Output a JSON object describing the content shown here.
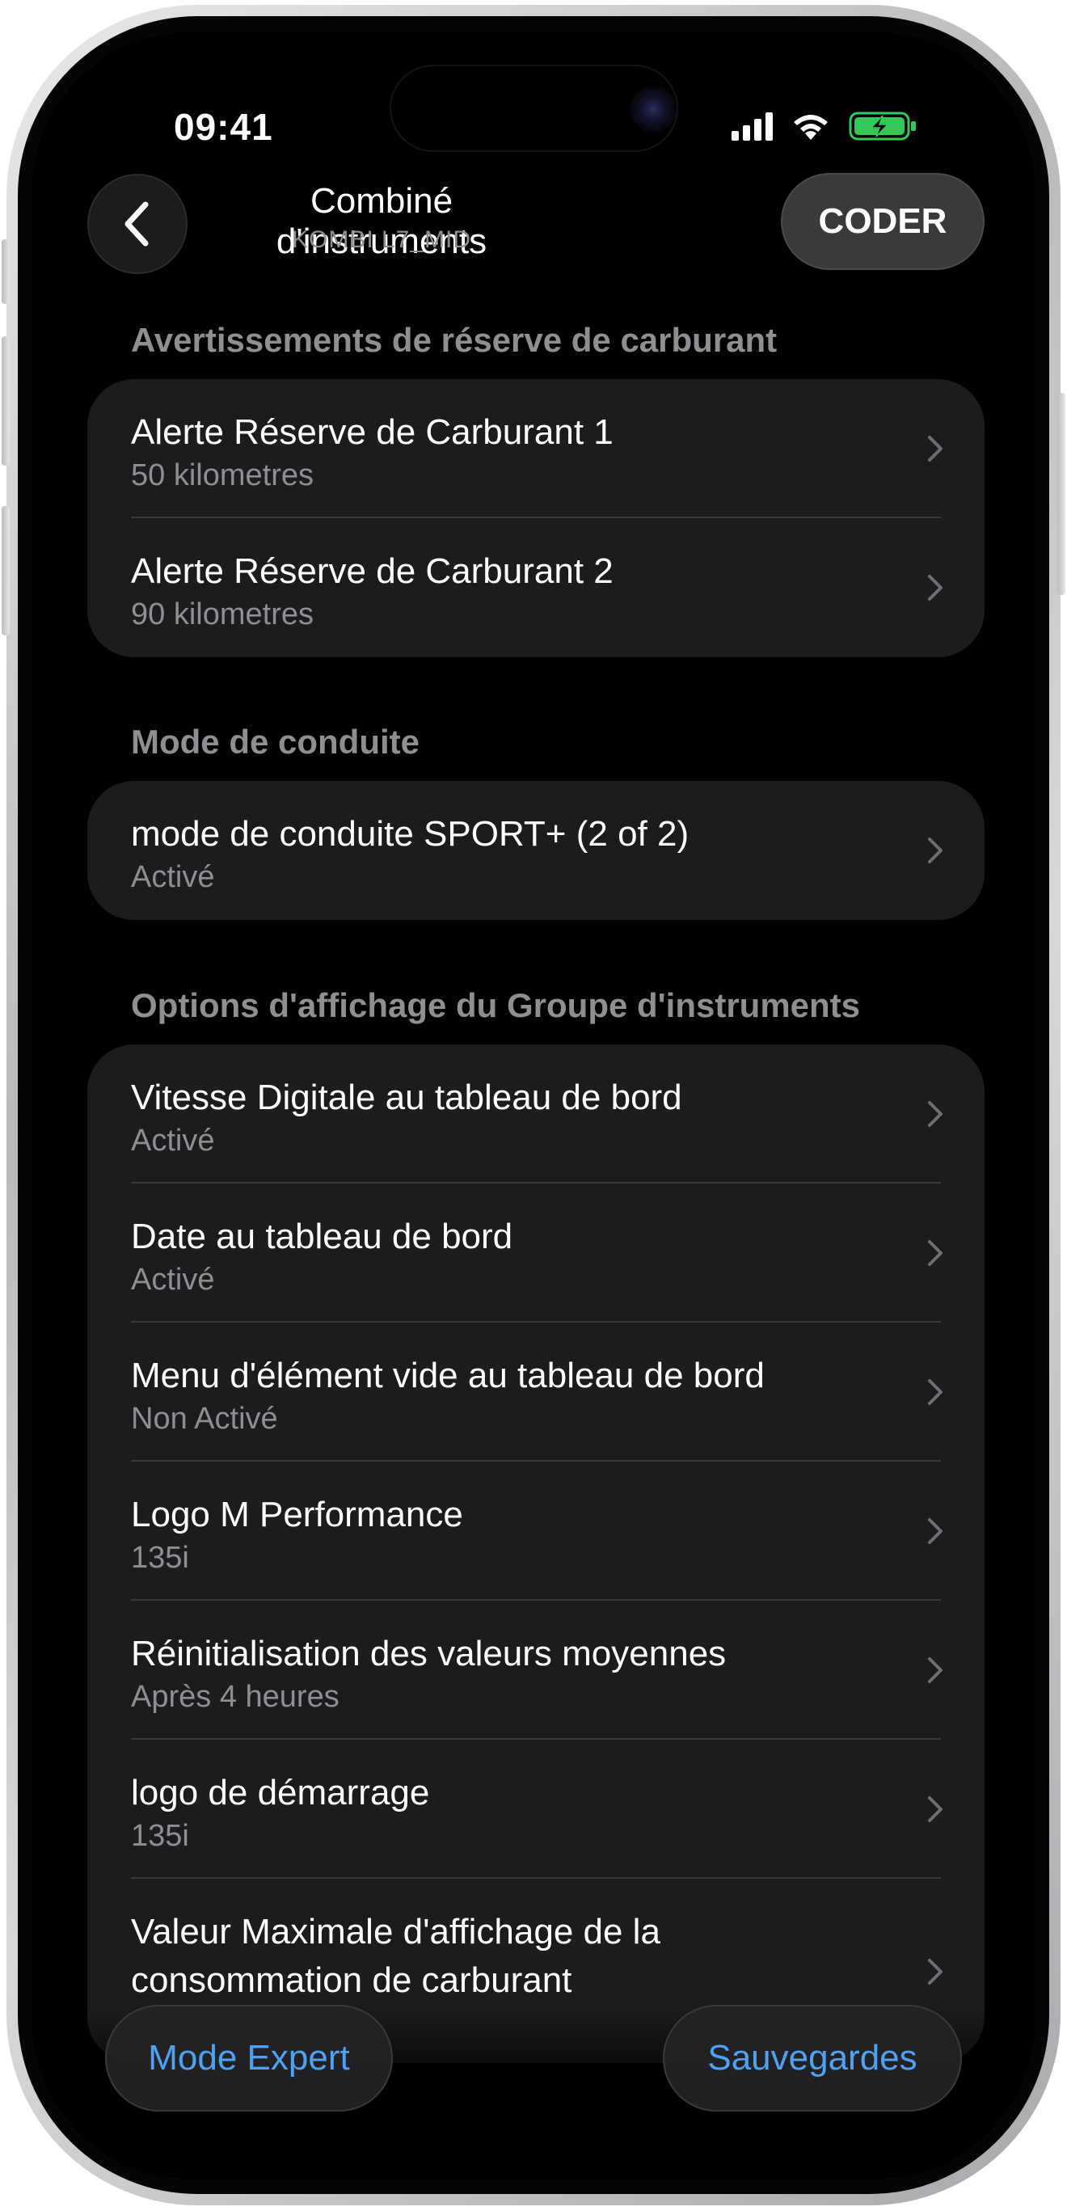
{
  "status_bar": {
    "time": "09:41",
    "icons": [
      "cellular-signal-icon",
      "wifi-icon",
      "battery-charging-icon"
    ],
    "battery_color": "#34c759"
  },
  "nav": {
    "back_icon": "chevron-left-icon",
    "title": "Combiné d'instruments",
    "subtitle": "KOMBI L7_MID",
    "action_label": "CODER"
  },
  "sections": [
    {
      "header": "Avertissements de réserve de carburant",
      "rows": [
        {
          "title": "Alerte Réserve de Carburant 1",
          "value": "50 kilometres"
        },
        {
          "title": "Alerte Réserve de Carburant 2",
          "value": "90 kilometres"
        }
      ]
    },
    {
      "header": "Mode de conduite",
      "rows": [
        {
          "title": "mode de conduite SPORT+ (2 of 2)",
          "value": "Activé"
        }
      ]
    },
    {
      "header": "Options d'affichage du Groupe d'instruments",
      "rows": [
        {
          "title": "Vitesse Digitale au tableau de bord",
          "value": "Activé"
        },
        {
          "title": "Date au tableau de bord",
          "value": "Activé"
        },
        {
          "title": "Menu d'élément vide au tableau de bord",
          "value": "Non Activé"
        },
        {
          "title": "Logo M Performance",
          "value": "135i"
        },
        {
          "title": "Réinitialisation des valeurs moyennes",
          "value": "Après 4 heures"
        },
        {
          "title": "logo de démarrage",
          "value": "135i"
        },
        {
          "title": "Valeur Maximale d'affichage de la consommation de carburant",
          "value": ""
        }
      ]
    }
  ],
  "bottom_bar": {
    "left_label": "Mode Expert",
    "right_label": "Sauvegardes",
    "accent": "#4ea1f3"
  }
}
